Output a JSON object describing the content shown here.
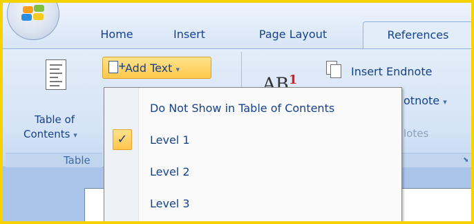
{
  "tabs": [
    "Home",
    "Insert",
    "Page Layout",
    "References"
  ],
  "active_tab": "References",
  "ribbon": {
    "toc_button_line1": "Table of",
    "toc_button_line2": "Contents",
    "toc_group_label": "Table",
    "add_text_label": "Add Text",
    "insert_endnote_label": "Insert Endnote",
    "footnote_partial": "otnote",
    "footnotes_group_partial": "lotes",
    "ab_text": "AB",
    "ab_sup": "1"
  },
  "menu": {
    "items": [
      {
        "label": "Do Not Show in Table of Contents",
        "checked": false
      },
      {
        "label": "Level 1",
        "checked": true
      },
      {
        "label": "Level 2",
        "checked": false
      },
      {
        "label": "Level 3",
        "checked": false
      }
    ],
    "check_glyph": "✓"
  },
  "colors": {
    "frame_border": "#f6d200",
    "ribbon_text": "#15428b",
    "highlight": "#ffc84a"
  }
}
